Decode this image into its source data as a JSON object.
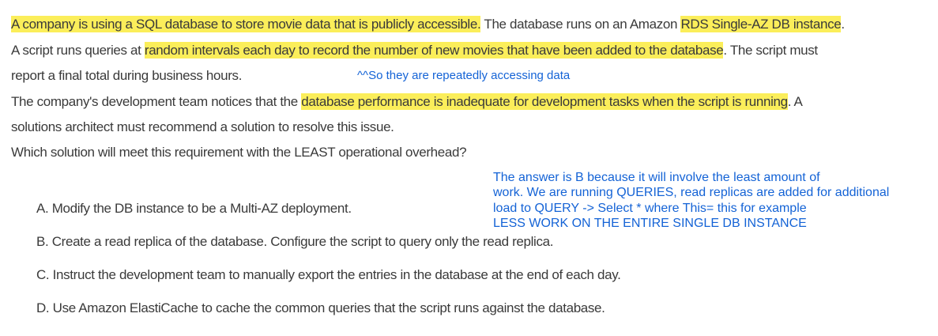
{
  "question": {
    "line1": {
      "hl1": "A company is using a SQL database to store movie data that is publicly accessible.",
      "t1": " The database runs on an Amazon ",
      "hl2": "RDS Single-AZ DB instance",
      "t2": "."
    },
    "line2": {
      "t1": "A script runs queries at ",
      "hl1": "random intervals each day to record the number of new movies that have been added to the database",
      "t2": ". The script must"
    },
    "line3": "report a final total during business hours.",
    "line4": {
      "t1": "The company's development team notices that the ",
      "hl1": "database performance is inadequate for development tasks when the script is running",
      "t2": ". A"
    },
    "line5": "solutions architect must recommend a solution to resolve this issue.",
    "line6": "Which solution will meet this requirement with the LEAST operational overhead?"
  },
  "notes": {
    "access_note": "^^So they are repeatedly accessing data",
    "answer_note": [
      "The answer is B because it will involve the least amount of",
      "work. We are running QUERIES, read replicas are added for additional",
      "load to QUERY -> Select * where This= this for example",
      "LESS WORK ON THE ENTIRE SINGLE DB INSTANCE"
    ]
  },
  "options": {
    "a": "A. Modify the DB instance to be a Multi-AZ deployment.",
    "b": "B. Create a read replica of the database. Configure the script to query only the read replica.",
    "c": "C. Instruct the development team to manually export the entries in the database at the end of each day.",
    "d": "D. Use Amazon ElastiCache to cache the common queries that the script runs against the database."
  },
  "colors": {
    "highlight": "#fbee5a",
    "annotation": "#1463d6",
    "text": "#3a3a3a"
  }
}
